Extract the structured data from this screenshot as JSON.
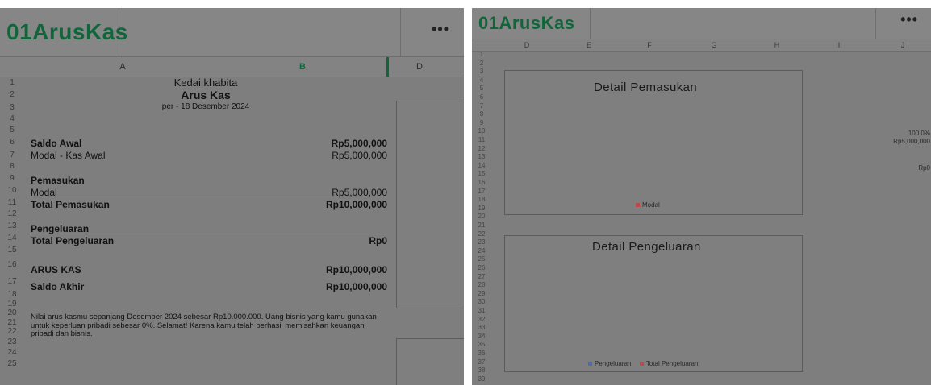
{
  "app": {
    "title": "01ArusKas",
    "more_label": "•••"
  },
  "left": {
    "columns": [
      "A",
      "B",
      "D"
    ],
    "rows": [
      "1",
      "2",
      "3",
      "4",
      "5",
      "6",
      "7",
      "8",
      "9",
      "10",
      "11",
      "12",
      "13",
      "14",
      "15",
      "16",
      "17",
      "18",
      "19",
      "20",
      "21",
      "22",
      "23",
      "24",
      "25"
    ],
    "sheet": {
      "company": "Kedai khabita",
      "report_title": "Arus Kas",
      "period": "per - 18 Desember 2024",
      "saldo_awal_label": "Saldo Awal",
      "saldo_awal_value": "Rp5,000,000",
      "modal_kas_label": "Modal - Kas Awal",
      "modal_kas_value": "Rp5,000,000",
      "pemasukan_label": "Pemasukan",
      "modal_label": "Modal",
      "modal_value": "Rp5,000,000",
      "total_pemasukan_label": "Total Pemasukan",
      "total_pemasukan_value": "Rp10,000,000",
      "pengeluaran_label": "Pengeluaran",
      "total_pengeluaran_label": "Total Pengeluaran",
      "total_pengeluaran_value": "Rp0",
      "arus_kas_label": "ARUS KAS",
      "arus_kas_value": "Rp10,000,000",
      "saldo_akhir_label": "Saldo Akhir",
      "saldo_akhir_value": "Rp10,000,000",
      "note_line1": "Nilai arus kasmu sepanjang Desember 2024 sebesar Rp10.000.000. Uang bisnis yang kamu gunakan",
      "note_line2": "untuk keperluan pribadi sebesar 0%. Selamat! Karena kamu telah berhasil memisahkan keuangan",
      "note_line3": "pribadi dan bisnis."
    }
  },
  "right": {
    "columns": [
      "D",
      "E",
      "F",
      "G",
      "H",
      "I",
      "J"
    ],
    "rows": [
      "1",
      "2",
      "3",
      "4",
      "5",
      "6",
      "7",
      "8",
      "9",
      "10",
      "11",
      "12",
      "13",
      "14",
      "15",
      "16",
      "17",
      "18",
      "19",
      "20",
      "21",
      "22",
      "23",
      "24",
      "25",
      "26",
      "27",
      "28",
      "29",
      "30",
      "31",
      "32",
      "33",
      "34",
      "35",
      "36",
      "37",
      "38",
      "39"
    ],
    "chart1": {
      "title": "Detail Pemasukan",
      "legend": [
        "Modal"
      ]
    },
    "chart2": {
      "title": "Detail Pengeluaran",
      "legend": [
        "Pengeluaran",
        "Total Pengeluaran"
      ]
    },
    "side_values": {
      "percent": "100.0%",
      "amount": "Rp5,000,000",
      "rp": "Rp0"
    }
  },
  "colors": {
    "brand": "#10663a",
    "legend_blue": "#4a6fa8",
    "legend_red": "#b84a4a"
  }
}
